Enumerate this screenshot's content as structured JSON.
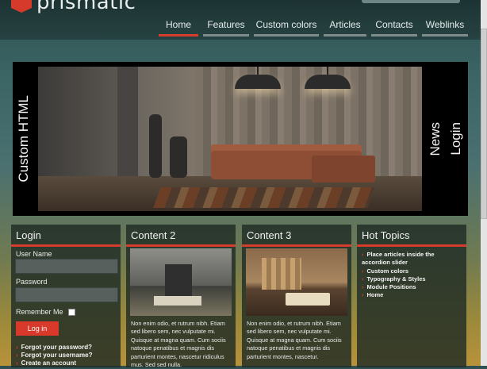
{
  "header": {
    "logo_text": "prismatic",
    "nav": [
      {
        "label": "Home",
        "active": true
      },
      {
        "label": "Features",
        "active": false
      },
      {
        "label": "Custom colors",
        "active": false
      },
      {
        "label": "Articles",
        "active": false
      },
      {
        "label": "Contacts",
        "active": false
      },
      {
        "label": "Weblinks",
        "active": false
      }
    ]
  },
  "banner": {
    "left_label": "Custom HTML",
    "right_labels": [
      "News",
      "Login"
    ]
  },
  "login": {
    "title": "Login",
    "username_label": "User Name",
    "username_value": "",
    "password_label": "Password",
    "password_value": "",
    "remember_label": "Remember Me",
    "remember_checked": false,
    "button_label": "Log in",
    "links": [
      "Forgot your password?",
      "Forgot your username?",
      "Create an account"
    ]
  },
  "content2": {
    "title": "Content 2",
    "text": "Non enim odio, et rutrum nibh. Etiam sed libero sem, nec vulputate mi. Quisque at magna quam. Cum sociis natoque penatibus et magnis dis parturient montes, nascetur ridiculus mus. Sed sed nulla."
  },
  "content3": {
    "title": "Content 3",
    "text": "Non enim odio, et rutrum nibh. Etiam sed libero sem, nec vulputate mi. Quisque at magna quam. Cum sociis natoque penatibus et magnis dis parturient montes, nascetur."
  },
  "hot_topics": {
    "title": "Hot Topics",
    "items": [
      "Place articles inside the accordion slider",
      "Custom colors",
      "Typography & Styles",
      "Module Positions",
      "Home"
    ]
  },
  "colors": {
    "accent": "#d43c2c"
  }
}
